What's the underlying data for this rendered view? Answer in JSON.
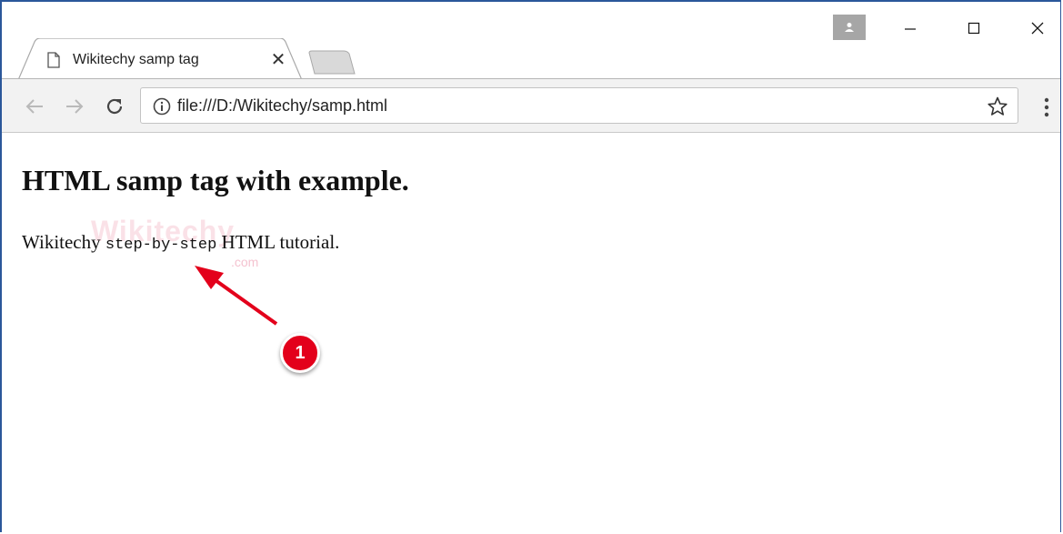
{
  "tab": {
    "title": "Wikitechy samp tag",
    "close_label": "✕"
  },
  "toolbar": {
    "url": "file:///D:/Wikitechy/samp.html"
  },
  "page": {
    "heading": "HTML samp tag with example.",
    "para_before": "Wikitechy ",
    "samp_text": "step-by-step",
    "para_after": " HTML tutorial."
  },
  "watermark": {
    "brand": "Wikitechy",
    "suffix": ".com"
  },
  "annotation": {
    "badge": "1"
  },
  "colors": {
    "accent_red": "#e3001b",
    "window_border": "#2b579a"
  }
}
